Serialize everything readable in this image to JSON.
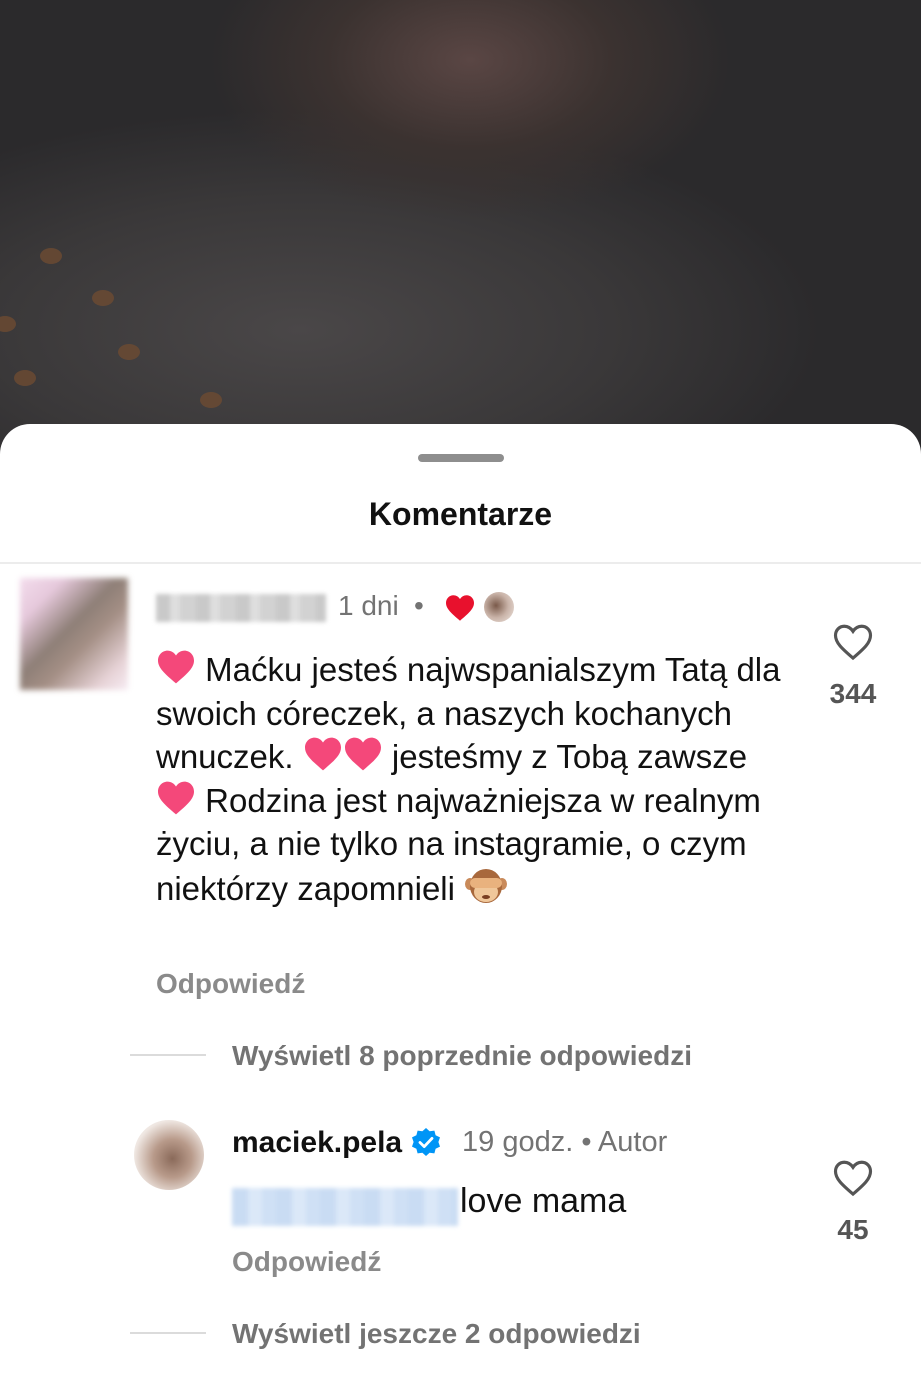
{
  "sheet": {
    "title": "Komentarze"
  },
  "comment": {
    "time": "1 dni",
    "bullet": "•",
    "text_parts": {
      "p1": "Maćku jesteś najwspanialszym Tatą dla swoich córeczek, a naszych kochanych wnuczek.",
      "p2": "jesteśmy z Tobą zawsze",
      "p3": "Rodzina jest najważniejsza w realnym życiu, a nie tylko na instagramie, o czym niektórzy zapomnieli"
    },
    "reply_label": "Odpowiedź",
    "like_count": "344",
    "view_previous_replies": "Wyświetl 8 poprzednie odpowiedzi"
  },
  "reply": {
    "author": "maciek.pela",
    "time_meta": "19 godz. • Autor",
    "text": "love mama",
    "reply_label": "Odpowiedź",
    "like_count": "45",
    "view_more_replies": "Wyświetl jeszcze 2 odpowiedzi"
  },
  "colors": {
    "heart_red": "#e8112d",
    "verified_blue": "#0095f6",
    "muted_text": "#737373"
  },
  "icons": [
    "heart-emoji",
    "see-no-evil-monkey-emoji",
    "like-heart-outline-icon",
    "verified-badge-icon"
  ]
}
